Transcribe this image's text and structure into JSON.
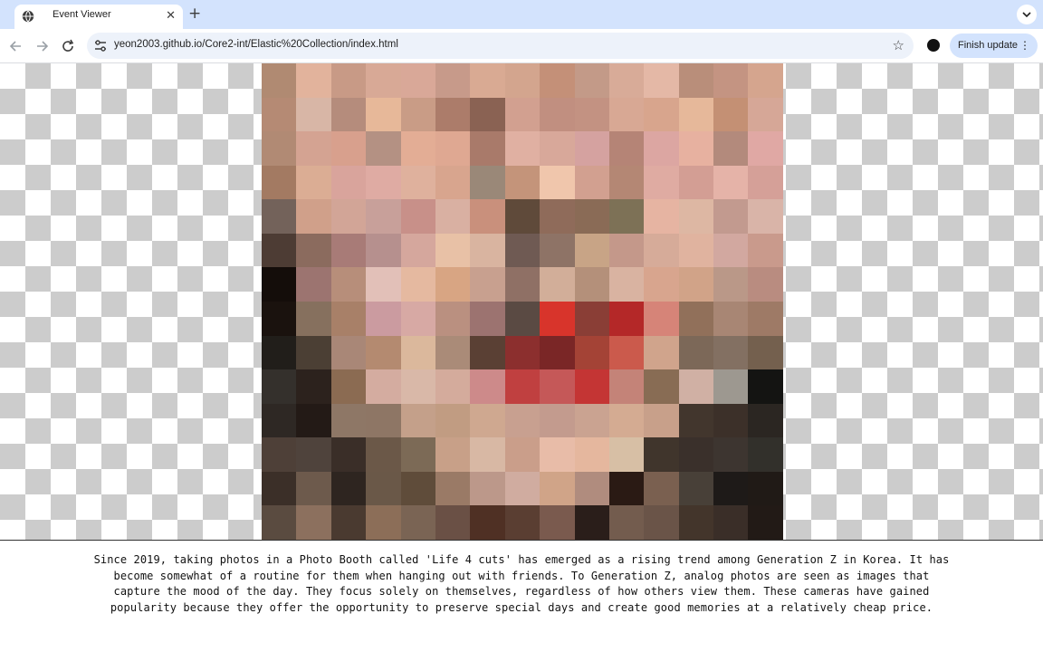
{
  "browser": {
    "tab_title": "Event Viewer",
    "url": "yeon2003.github.io/Core2-int/Elastic%20Collection/index.html",
    "update_label": "Finish update"
  },
  "page": {
    "caption_lines": [
      "Since 2019, taking photos in a Photo Booth called 'Life 4 cuts' has emerged as a rising trend among Generation Z in Korea. It has",
      "become somewhat of a routine for them when hanging out with friends. To Generation Z, analog photos are seen as images that",
      "capture the mood of the day. They focus solely on themselves, regardless of how others view them. These cameras have gained",
      "popularity because they offer the opportunity to preserve special days and create good memories at a relatively cheap price."
    ]
  },
  "mosaic": {
    "tile_colors": [
      "#b08a72",
      "#e2b39c",
      "#c89a86",
      "#d8a996",
      "#d9a898",
      "#c79a8a",
      "#d9aa93",
      "#d3a58e",
      "#c49078",
      "#c39a88",
      "#d8ab98",
      "#e4b8a6",
      "#b98e7a",
      "#c49482",
      "#d5a58e",
      "#b58a74",
      "#d8b6a6",
      "#b58c7c",
      "#e7b899",
      "#c99c86",
      "#ac7c6a",
      "#8a6253",
      "#d2a090",
      "#c18f80",
      "#c39282",
      "#d8a894",
      "#d8a58d",
      "#e6b89a",
      "#c49074",
      "#d6a797",
      "#b18a74",
      "#d4a392",
      "#d8a08d",
      "#b49183",
      "#e3ad95",
      "#dfa892",
      "#a97a6a",
      "#e0b0a2",
      "#d8a89a",
      "#d5a2a0",
      "#b58476",
      "#dca6a2",
      "#e7b1a0",
      "#b38a7c",
      "#e0a8a4",
      "#a37a62",
      "#dbad94",
      "#d9a49c",
      "#dfaba3",
      "#dfb19d",
      "#d8a58e",
      "#9a8878",
      "#c4947a",
      "#f0c6ac",
      "#d2a090",
      "#b48774",
      "#dfaba2",
      "#d39e94",
      "#e5b3a8",
      "#d5a098",
      "#73625a",
      "#d0a08a",
      "#d2a597",
      "#c8a09a",
      "#c89089",
      "#d9b0a2",
      "#c9907c",
      "#5f4a3a",
      "#8f6b5a",
      "#8a6b56",
      "#7d7156",
      "#e6b4a2",
      "#ddb7a3",
      "#c29a8f",
      "#d9b4a8",
      "#4d3c34",
      "#8b6b5e",
      "#a87b77",
      "#b6908e",
      "#d5a79d",
      "#e8c1a6",
      "#d9b4a0",
      "#6f5a53",
      "#8e7366",
      "#c8a486",
      "#c4988a",
      "#d6ab99",
      "#e0b39f",
      "#d2a8a0",
      "#c99a8c",
      "#140d0a",
      "#9c7470",
      "#b78e7a",
      "#e2c0b8",
      "#e5b9a0",
      "#d8a583",
      "#c8a08f",
      "#8f7065",
      "#d2ae99",
      "#b4907a",
      "#d9b3a1",
      "#d8a58e",
      "#d1a388",
      "#ba9888",
      "#b98c80",
      "#1a120e",
      "#86705e",
      "#a88068",
      "#cb9ba0",
      "#d7a9a4",
      "#ba9080",
      "#9c7370",
      "#5a4a43",
      "#d8342b",
      "#8a3e36",
      "#b42828",
      "#d68478",
      "#91705a",
      "#a88674",
      "#9e7a66",
      "#211e1a",
      "#4b3f34",
      "#a98777",
      "#b48a70",
      "#dbb89c",
      "#aa8b78",
      "#5a4034",
      "#8c2f2e",
      "#7a2626",
      "#a44336",
      "#cb5a4c",
      "#d0a48c",
      "#7c6858",
      "#837062",
      "#74604e",
      "#34302c",
      "#2c221d",
      "#8b6b52",
      "#d4aca0",
      "#d9b8a8",
      "#d4ab9c",
      "#cd8a8a",
      "#c04040",
      "#c55858",
      "#c43534",
      "#c48378",
      "#886c54",
      "#d0b0a4",
      "#9d9890",
      "#141412",
      "#2e2824",
      "#231a16",
      "#8e7766",
      "#8e7665",
      "#c4a08a",
      "#c19c82",
      "#cfa890",
      "#c8a090",
      "#c39b8e",
      "#caa391",
      "#d4ab92",
      "#c8a08a",
      "#42362d",
      "#3c3029",
      "#2b2622",
      "#4e4038",
      "#4f433c",
      "#3a2e28",
      "#6b5848",
      "#7c6a56",
      "#c8a088",
      "#d8b8a4",
      "#ca9e8a",
      "#e8bca8",
      "#e5b79e",
      "#d7bfa5",
      "#40352c",
      "#3a302b",
      "#3d3530",
      "#32302b",
      "#3b2f28",
      "#6d5a4c",
      "#2e2520",
      "#6a5848",
      "#5f4c3a",
      "#9a7a66",
      "#bc988a",
      "#d0aca0",
      "#d0a488",
      "#b08c7e",
      "#2a1a14",
      "#7a6050",
      "#484038",
      "#1e1a18",
      "#201a16",
      "#5a4b40",
      "#8c705e",
      "#4a3a30",
      "#8c6e58",
      "#7a6454",
      "#6a5045",
      "#4f3024",
      "#5a3e32",
      "#7a5a4e",
      "#2a1e1a",
      "#735c4e",
      "#6a5448",
      "#43352b",
      "#3a2e28",
      "#221a16"
    ]
  }
}
